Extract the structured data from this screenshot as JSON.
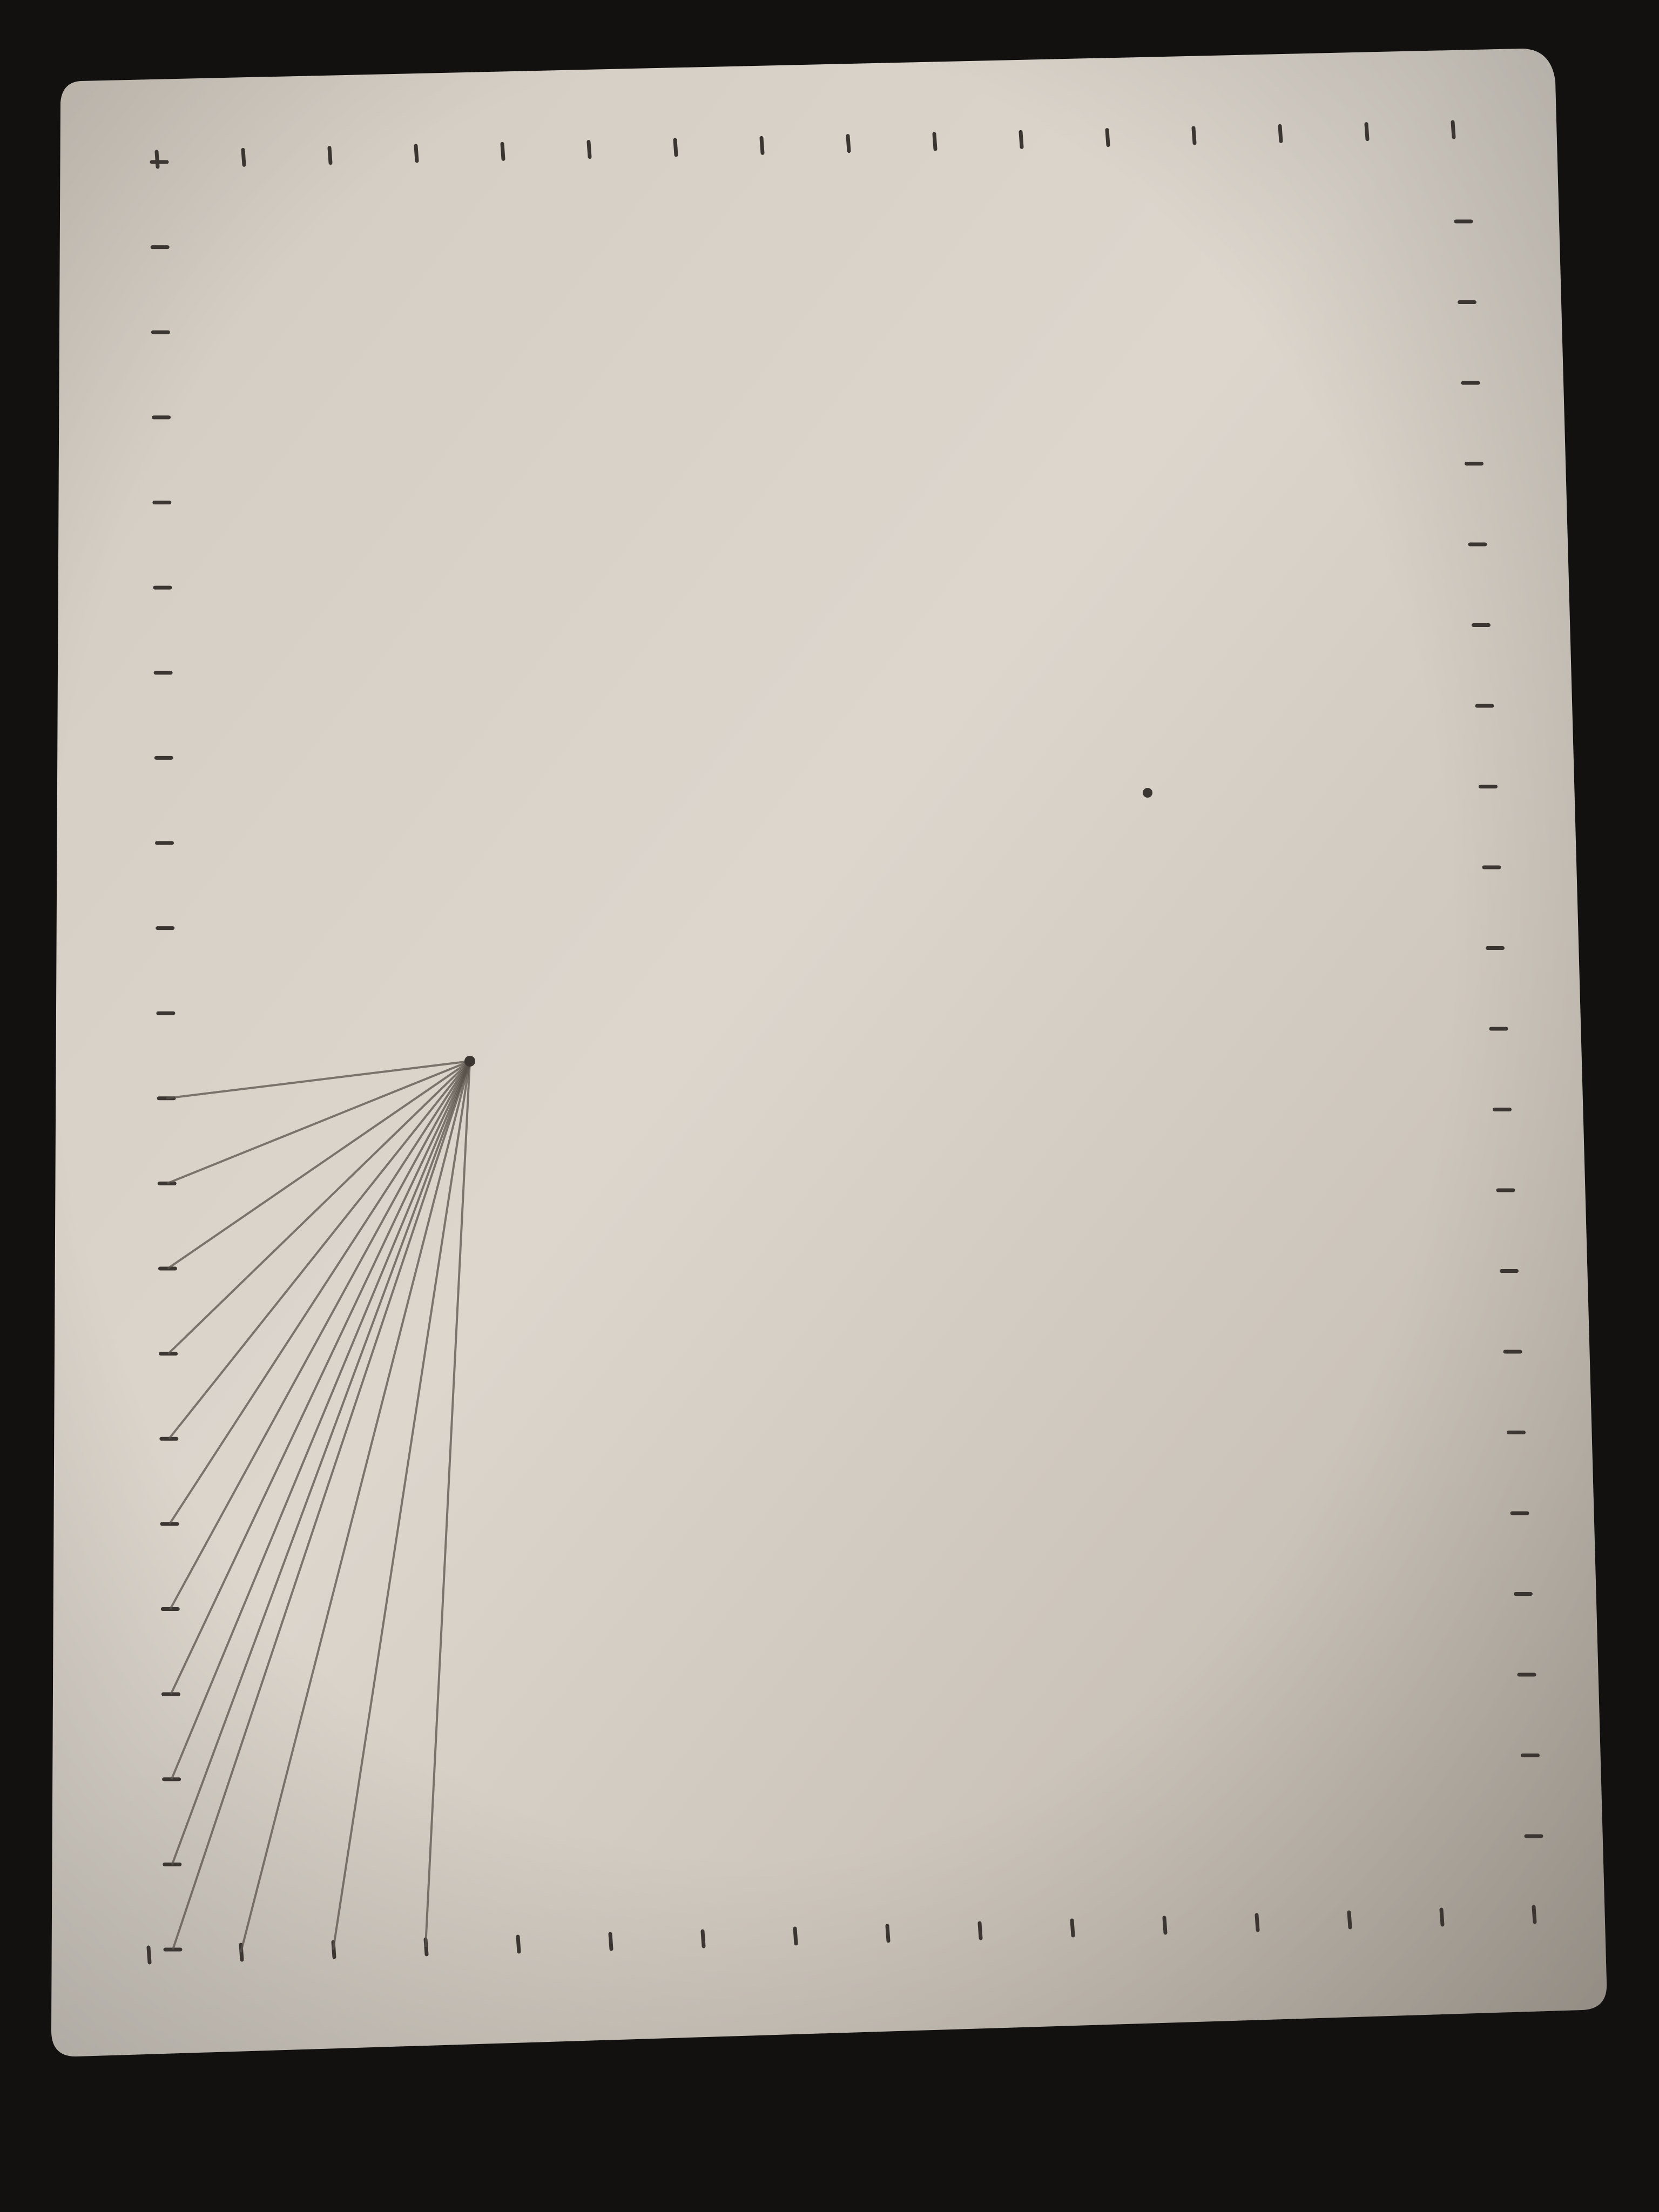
{
  "photo": {
    "subject": "sheet-of-paper",
    "colors": {
      "background": "#121110",
      "paper_light": "#d9d3ca",
      "paper_mid": "#c9c2b8",
      "paper_shadow": "#b3ab9f",
      "pencil": "#5a534c",
      "tick": "#3b3631"
    },
    "left_tick_count": 22,
    "top_tick_count": 16,
    "right_tick_count": 21,
    "bottom_tick_count": 16,
    "fan_line_count": 14
  }
}
